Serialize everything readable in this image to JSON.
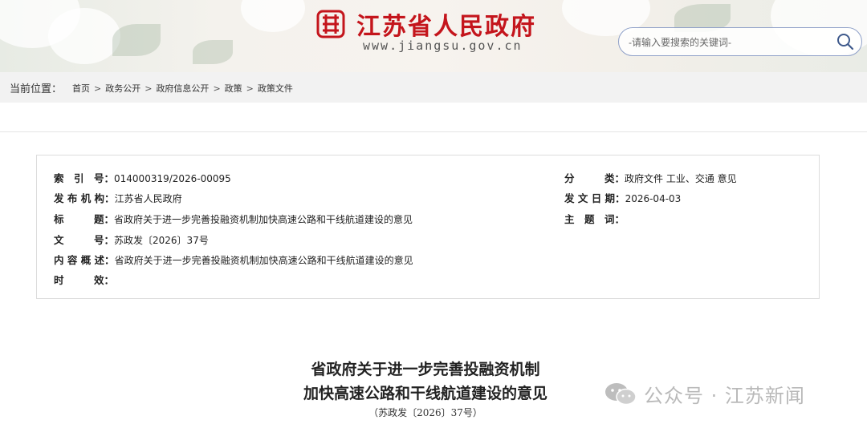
{
  "header": {
    "site_name": "江苏省人民政府",
    "site_url": "www.jiangsu.gov.cn",
    "brand_color": "#c4151c",
    "search": {
      "placeholder": "-请输入要搜索的关键词-"
    },
    "search_icon": "search-icon"
  },
  "breadcrumb": {
    "label": "当前位置：",
    "items": [
      "首页",
      "政务公开",
      "政府信息公开",
      "政策",
      "政策文件"
    ],
    "separator": ">"
  },
  "meta": {
    "index_key": "索　引　号：",
    "index_val": "014000319/2026-00095",
    "category_key": "分　　　类：",
    "category_val": "政府文件 工业、交通 意见",
    "publisher_key": "发 布 机 构：",
    "publisher_val": "江苏省人民政府",
    "date_key": "发 文 日 期：",
    "date_val": "2026-04-03",
    "title_key": "标　　　题：",
    "title_val": "省政府关于进一步完善投融资机制加快高速公路和干线航道建设的意见",
    "subject_key": "主　题　词：",
    "subject_val": "",
    "docno_key": "文　　　号：",
    "docno_val": "苏政发〔2026〕37号",
    "summary_key": "内 容 概 述：",
    "summary_val": "省政府关于进一步完善投融资机制加快高速公路和干线航道建设的意见",
    "validity_key": "时　　　效：",
    "validity_val": ""
  },
  "document": {
    "title_line1": "省政府关于进一步完善投融资机制",
    "title_line2": "加快高速公路和干线航道建设的意见",
    "number": "（苏政发〔2026〕37号）"
  },
  "watermark": {
    "text": "公众号 · 江苏新闻",
    "icon": "wechat-icon"
  }
}
